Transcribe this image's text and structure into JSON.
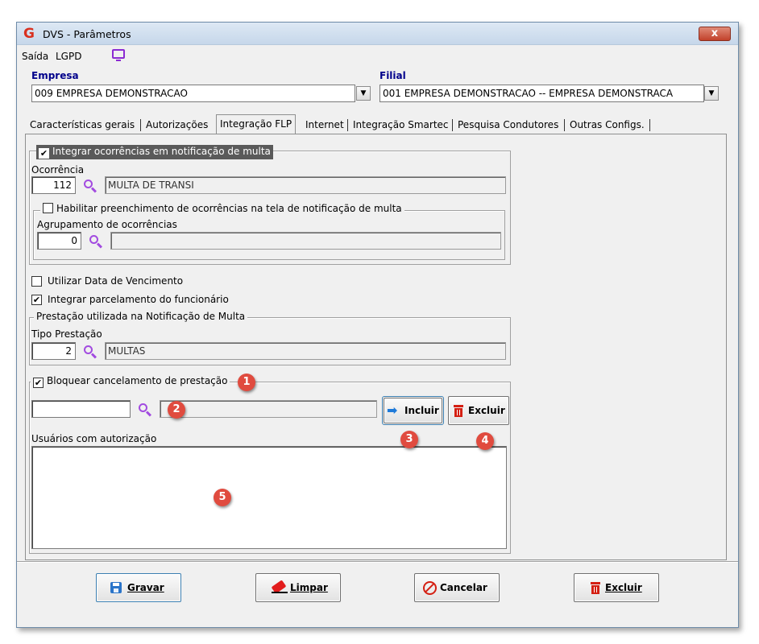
{
  "window": {
    "title": "DVS - Parâmetros",
    "close_label": "x"
  },
  "menu": {
    "items": [
      {
        "label": "Saída"
      },
      {
        "label": "LGPD"
      }
    ]
  },
  "empresa": {
    "label": "Empresa",
    "value": "009 EMPRESA DEMONSTRACAO"
  },
  "filial": {
    "label": "Filial",
    "value": "001 EMPRESA DEMONSTRACAO -- EMPRESA DEMONSTRACA"
  },
  "tabs": [
    {
      "label": "Características gerais"
    },
    {
      "label": "Autorizações"
    },
    {
      "label": "Integração FLP",
      "active": true
    },
    {
      "label": "Internet"
    },
    {
      "label": "Integração Smartec"
    },
    {
      "label": "Pesquisa Condutores"
    },
    {
      "label": "Outras Configs."
    }
  ],
  "integrar_ocorrencias": {
    "label": "Integrar ocorrências em notificação de multa",
    "checked": true,
    "ocorrencia_label": "Ocorrência",
    "ocorrencia_code": "112",
    "ocorrencia_desc": "MULTA DE TRANSI",
    "habilitar_label": "Habilitar preenchimento de ocorrências na tela de notificação de multa",
    "habilitar_checked": false,
    "agrupamento_label": "Agrupamento de ocorrências",
    "agrupamento_code": "0",
    "agrupamento_desc": ""
  },
  "utilizar_data": {
    "label": "Utilizar Data de Vencimento",
    "checked": false
  },
  "integrar_parcelamento": {
    "label": "Integrar parcelamento do funcionário",
    "checked": true
  },
  "prestacao": {
    "group_label": "Prestação utilizada na Notificação de Multa",
    "tipo_label": "Tipo Prestação",
    "tipo_code": "2",
    "tipo_desc": "MULTAS"
  },
  "bloquear": {
    "label": "Bloquear cancelamento de prestação",
    "checked": true,
    "user_code": "",
    "user_desc": "",
    "incluir_label": "Incluir",
    "excluir_label": "Excluir",
    "usuarios_label": "Usuários com autorização",
    "usuarios": []
  },
  "badges": [
    "1",
    "2",
    "3",
    "4",
    "5"
  ],
  "footer": {
    "gravar_label": "Gravar",
    "limpar_label": "Limpar",
    "cancelar_label": "Cancelar",
    "excluir_label": "Excluir"
  },
  "colors": {
    "accent_label": "#00008b",
    "badge": "#e04b3f",
    "search_icon": "#a24be0",
    "trash_icon": "#d41f12"
  },
  "icons": [
    "app-logo-icon",
    "close-icon",
    "monitor-icon",
    "search-icon",
    "arrow-right-icon",
    "trash-icon",
    "save-icon",
    "eraser-icon",
    "cancel-icon"
  ]
}
